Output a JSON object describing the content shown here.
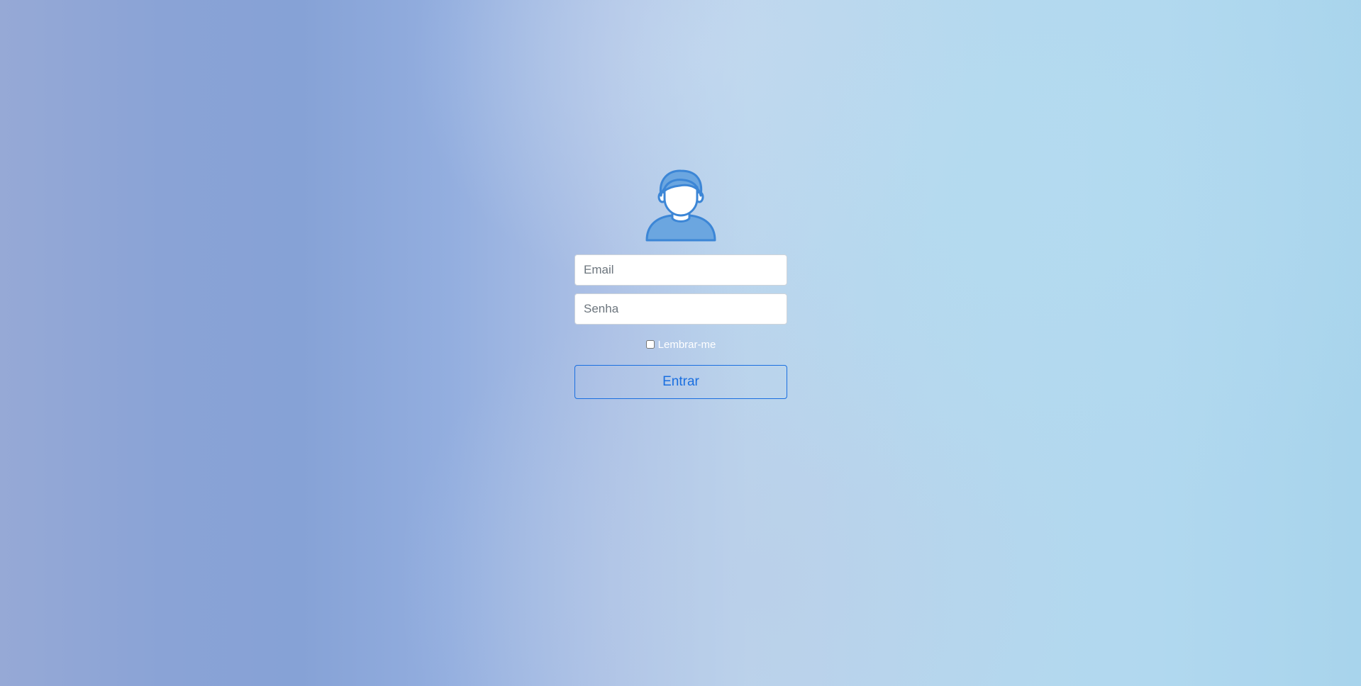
{
  "login": {
    "avatar_icon": "user-avatar-icon",
    "email": {
      "placeholder": "Email",
      "value": ""
    },
    "password": {
      "placeholder": "Senha",
      "value": ""
    },
    "remember": {
      "label": "Lembrar-me",
      "checked": false
    },
    "submit_label": "Entrar"
  },
  "colors": {
    "accent": "#1a6fe0",
    "avatar_fill": "#6ba6e0",
    "avatar_stroke": "#3c86d6"
  }
}
